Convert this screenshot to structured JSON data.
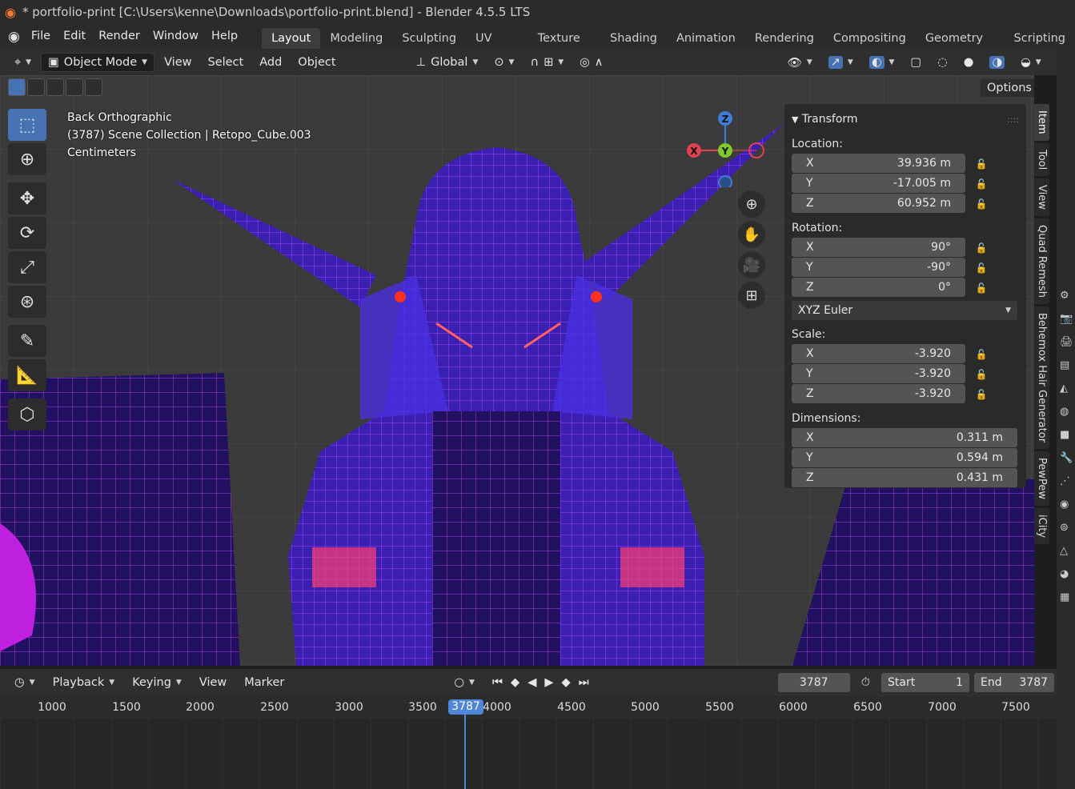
{
  "window": {
    "title": "* portfolio-print [C:\\Users\\kenne\\Downloads\\portfolio-print.blend] - Blender 4.5.5 LTS"
  },
  "menu": [
    "File",
    "Edit",
    "Render",
    "Window",
    "Help"
  ],
  "workspaces": [
    "Layout",
    "Modeling",
    "Sculpting",
    "UV Editing",
    "Texture Paint",
    "Shading",
    "Animation",
    "Rendering",
    "Compositing",
    "Geometry Nodes",
    "Scripting"
  ],
  "viewport_header": {
    "mode": "Object Mode",
    "menus": [
      "View",
      "Select",
      "Add",
      "Object"
    ],
    "orientation": "Global"
  },
  "options_label": "Options",
  "overlay": {
    "view": "Back Orthographic",
    "collection": "(3787) Scene Collection | Retopo_Cube.003",
    "units": "Centimeters"
  },
  "gizmo": {
    "x": "X",
    "y": "Y",
    "z": "Z"
  },
  "transform": {
    "title": "Transform",
    "location_label": "Location:",
    "location": [
      {
        "axis": "X",
        "value": "39.936 m"
      },
      {
        "axis": "Y",
        "value": "-17.005 m"
      },
      {
        "axis": "Z",
        "value": "60.952 m"
      }
    ],
    "rotation_label": "Rotation:",
    "rotation": [
      {
        "axis": "X",
        "value": "90°"
      },
      {
        "axis": "Y",
        "value": "-90°"
      },
      {
        "axis": "Z",
        "value": "0°"
      }
    ],
    "rotation_mode": "XYZ Euler",
    "scale_label": "Scale:",
    "scale": [
      {
        "axis": "X",
        "value": "-3.920"
      },
      {
        "axis": "Y",
        "value": "-3.920"
      },
      {
        "axis": "Z",
        "value": "-3.920"
      }
    ],
    "dimensions_label": "Dimensions:",
    "dimensions": [
      {
        "axis": "X",
        "value": "0.311 m"
      },
      {
        "axis": "Y",
        "value": "0.594 m"
      },
      {
        "axis": "Z",
        "value": "0.431 m"
      }
    ]
  },
  "side_tabs": [
    "Item",
    "Tool",
    "View",
    "Quad Remesh",
    "Behemox Hair Generator",
    "PewPew",
    "iCity"
  ],
  "timeline": {
    "menus": [
      "Playback",
      "Keying",
      "View",
      "Marker"
    ],
    "current_frame": "3787",
    "start_label": "Start",
    "start": "1",
    "end_label": "End",
    "end": "3787",
    "ticks": [
      "1000",
      "1500",
      "2000",
      "2500",
      "3000",
      "3500",
      "4000",
      "4500",
      "5000",
      "5500",
      "6000",
      "6500",
      "7000",
      "7500"
    ]
  }
}
